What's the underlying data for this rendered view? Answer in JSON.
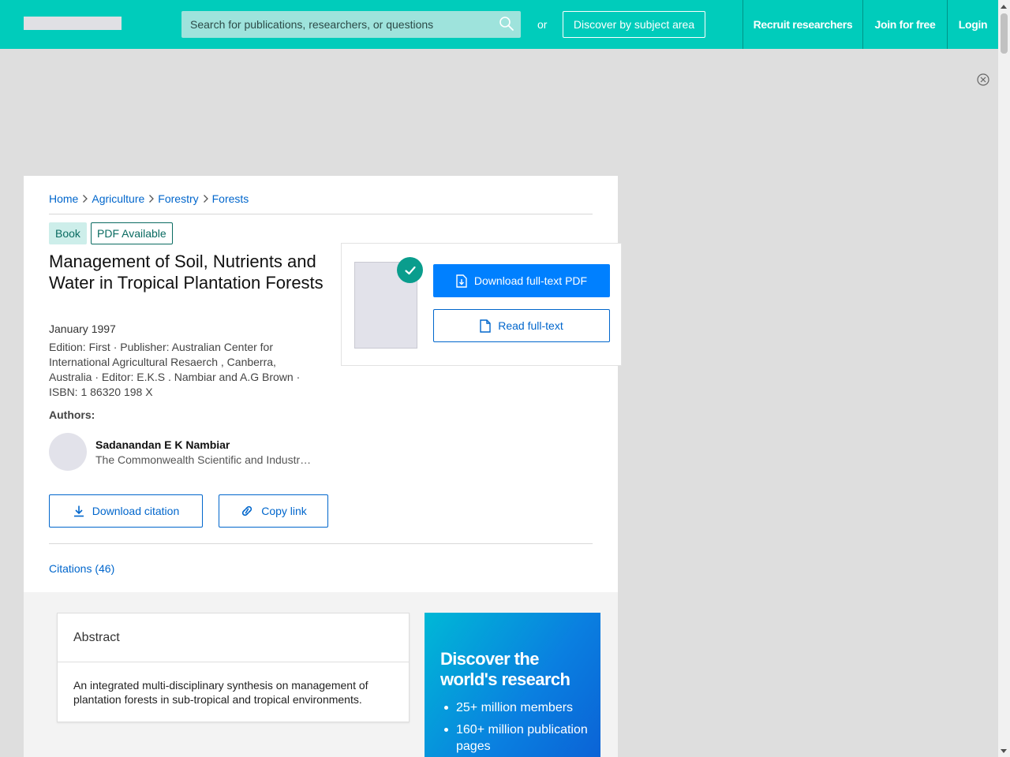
{
  "header": {
    "search_placeholder": "Search for publications, researchers, or questions",
    "or_text": "or",
    "discover_label": "Discover by subject area",
    "nav": [
      {
        "label": "Recruit researchers"
      },
      {
        "label": "Join for free"
      },
      {
        "label": "Login"
      }
    ]
  },
  "breadcrumb": [
    "Home",
    "Agriculture",
    "Forestry",
    "Forests"
  ],
  "badges": {
    "type": "Book",
    "availability": "PDF Available"
  },
  "publication": {
    "title": "Management of Soil, Nutrients and Water in Tropical Plantation Forests",
    "date": "January 1997",
    "details": "Edition: First · Publisher: Australian Center for International Agricultural Resaerch , Canberra, Australia · Editor: E.K.S . Nambiar and A.G Brown · ISBN: 1 86320 198 X"
  },
  "authors": {
    "label": "Authors:",
    "items": [
      {
        "name": "Sadanandan E K Nambiar",
        "institution": "The Commonwealth Scientific and Industrial Research Organisation"
      }
    ]
  },
  "actions": {
    "download_citation": "Download citation",
    "copy_link": "Copy link",
    "download_pdf": "Download full-text PDF",
    "read_fulltext": "Read full-text"
  },
  "tabs": {
    "citations": "Citations (46)"
  },
  "abstract": {
    "title": "Abstract",
    "text": "An integrated multi-disciplinary synthesis on management of plantation forests in sub-tropical and tropical environments."
  },
  "promo": {
    "title": "Discover the world's research",
    "items": [
      "25+ million members",
      "160+ million publication pages"
    ]
  },
  "colors": {
    "header_bg": "#00ccbb",
    "link_blue": "#0066cc",
    "primary_button": "#0080ff",
    "badge_teal": "#0a6b61"
  }
}
